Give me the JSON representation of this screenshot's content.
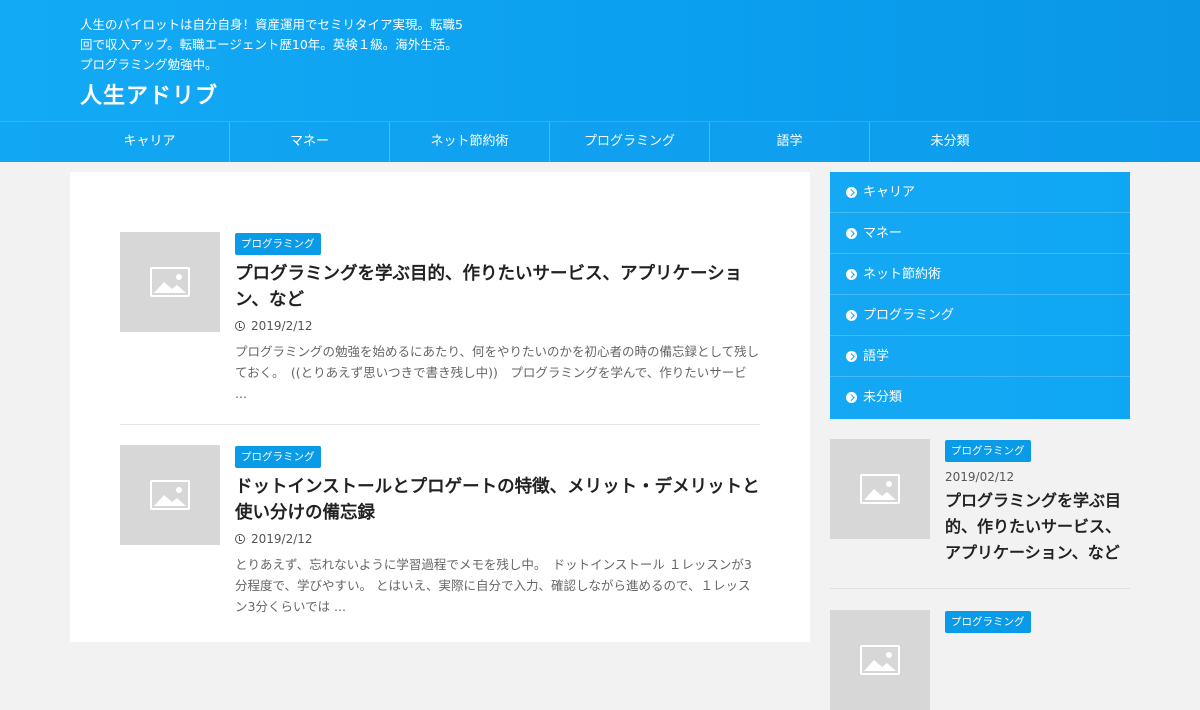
{
  "header": {
    "description": "人生のパイロットは自分自身！資産運用でセミリタイア実現。転職5回で収入アップ。転職エージェント歴10年。英検１級。海外生活。プログラミング勉強中。",
    "site_title": "人生アドリブ"
  },
  "nav": {
    "items": [
      "キャリア",
      "マネー",
      "ネット節約術",
      "プログラミング",
      "語学",
      "未分類"
    ]
  },
  "posts": [
    {
      "category": "プログラミング",
      "title": "プログラミングを学ぶ目的、作りたいサービス、アプリケーション、など",
      "date": "2019/2/12",
      "excerpt": "プログラミングの勉強を始めるにあたり、何をやりたいのかを初心者の時の備忘録として残しておく。　((とりあえず思いつきで書き残し中))　プログラミングを学んで、作りたいサービ ..."
    },
    {
      "category": "プログラミング",
      "title": "ドットインストールとプロゲートの特徴、メリット・デメリットと使い分けの備忘録",
      "date": "2019/2/12",
      "excerpt": "とりあえず、忘れないように学習過程でメモを残し中。　ドットインストール １レッスンが3分程度で、学びやすい。 とはいえ、実際に自分で入力、確認しながら進めるので、１レッスン3分くらいでは ..."
    }
  ],
  "sidebar": {
    "categories": [
      "キャリア",
      "マネー",
      "ネット節約術",
      "プログラミング",
      "語学",
      "未分類"
    ],
    "recent": [
      {
        "category": "プログラミング",
        "date": "2019/02/12",
        "title": "プログラミングを学ぶ目的、作りたいサービス、アプリケーション、など"
      },
      {
        "category": "プログラミング"
      }
    ]
  },
  "colors": {
    "accent": "#0a9be8",
    "header": "#13aaf5",
    "thumb": "#d7d7d7"
  },
  "icons": {
    "thumbnail": "image-placeholder-icon",
    "date": "clock-icon",
    "category_bullet": "chevron-circle-right-icon"
  }
}
